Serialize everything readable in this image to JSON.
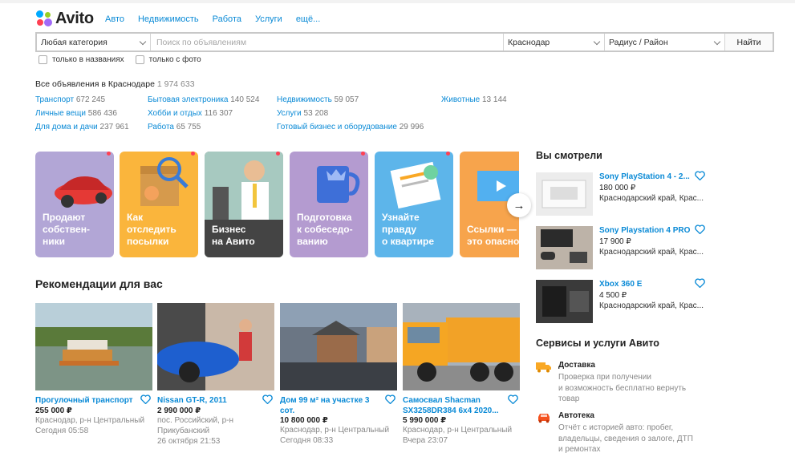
{
  "header": {
    "logo_text": "Avito",
    "nav": [
      "Авто",
      "Недвижимость",
      "Работа",
      "Услуги",
      "ещё..."
    ]
  },
  "search": {
    "category": "Любая категория",
    "placeholder": "Поиск по объявлениям",
    "city": "Краснодар",
    "radius": "Радиус / Район",
    "button": "Найти"
  },
  "filters": {
    "titles_only": "только в названиях",
    "with_photo": "только с фото"
  },
  "stats": {
    "label": "Все объявления в Краснодаре",
    "count": "1 974 633"
  },
  "categories": [
    {
      "name": "Транспорт",
      "count": "672 245"
    },
    {
      "name": "Личные вещи",
      "count": "586 436"
    },
    {
      "name": "Для дома и дачи",
      "count": "237 961"
    },
    {
      "name": "Бытовая электроника",
      "count": "140 524"
    },
    {
      "name": "Хобби и отдых",
      "count": "116 307"
    },
    {
      "name": "Работа",
      "count": "65 755"
    },
    {
      "name": "Недвижимость",
      "count": "59 057"
    },
    {
      "name": "Услуги",
      "count": "53 208"
    },
    {
      "name": "Готовый бизнес и оборудование",
      "count": "29 996"
    },
    {
      "name": "Животные",
      "count": "13 144"
    }
  ],
  "banners": [
    {
      "l1": "Продают",
      "l2": "собствен-",
      "l3": "ники",
      "color": "#a99bd0"
    },
    {
      "l1": "Как",
      "l2": "отследить",
      "l3": "посылки",
      "color": "#f9b43a"
    },
    {
      "l1": "Бизнес",
      "l2": "на Авито",
      "l3": "",
      "color": "#6a6a6a"
    },
    {
      "l1": "Подготовка",
      "l2": "к собеседо-",
      "l3": "ванию",
      "color": "#b496cc"
    },
    {
      "l1": "Узнайте",
      "l2": "правду",
      "l3": "о квартире",
      "color": "#4fb0e8"
    },
    {
      "l1": "Ссылки —",
      "l2": "это опасно",
      "l3": "",
      "color": "#f6a04a"
    }
  ],
  "recommendations": {
    "title": "Рекомендации для вас",
    "items": [
      {
        "name": "Прогулочный транспорт",
        "price": "255 000 ₽",
        "addr1": "Краснодар, р-н Центральный",
        "addr2": "",
        "date": "Сегодня 05:58"
      },
      {
        "name": "Nissan GT-R, 2011",
        "price": "2 990 000 ₽",
        "addr1": "пос. Российский, р-н",
        "addr2": "Прикубанский",
        "date": "26 октября 21:53"
      },
      {
        "name": "Дом 99 м² на участке 3 сот.",
        "price": "10 800 000 ₽",
        "addr1": "Краснодар, р-н Центральный",
        "addr2": "",
        "date": "Сегодня 08:33"
      },
      {
        "name": "Самосвал Shacman SX3258DR384 6x4 2020...",
        "price": "5 990 000 ₽",
        "addr1": "Краснодар, р-н Центральный",
        "addr2": "",
        "date": "Вчера 23:07"
      }
    ]
  },
  "seen": {
    "title": "Вы смотрели",
    "items": [
      {
        "name": "Sony PlayStation 4 - 2...",
        "price": "180 000 ₽",
        "addr": "Краснодарский край, Крас..."
      },
      {
        "name": "Sony Playstation 4 PRO",
        "price": "17 900 ₽",
        "addr": "Краснодарский край, Крас..."
      },
      {
        "name": "Xbox 360 E",
        "price": "4 500 ₽",
        "addr": "Краснодарский край, Крас..."
      }
    ]
  },
  "services": {
    "title": "Сервисы и услуги Авито",
    "items": [
      {
        "name": "Доставка",
        "d1": "Проверка при получении",
        "d2": "и возможность бесплатно вернуть",
        "d3": "товар",
        "icon": "truck-icon"
      },
      {
        "name": "Автотека",
        "d1": "Отчёт с историей авто: пробег,",
        "d2": "владельцы, сведения о залоге, ДТП",
        "d3": "и ремонтах",
        "icon": "car-icon"
      }
    ]
  },
  "colors": {
    "link": "#0a8ad6",
    "accent_red": "#ff4053",
    "orange": "#f9a825"
  }
}
